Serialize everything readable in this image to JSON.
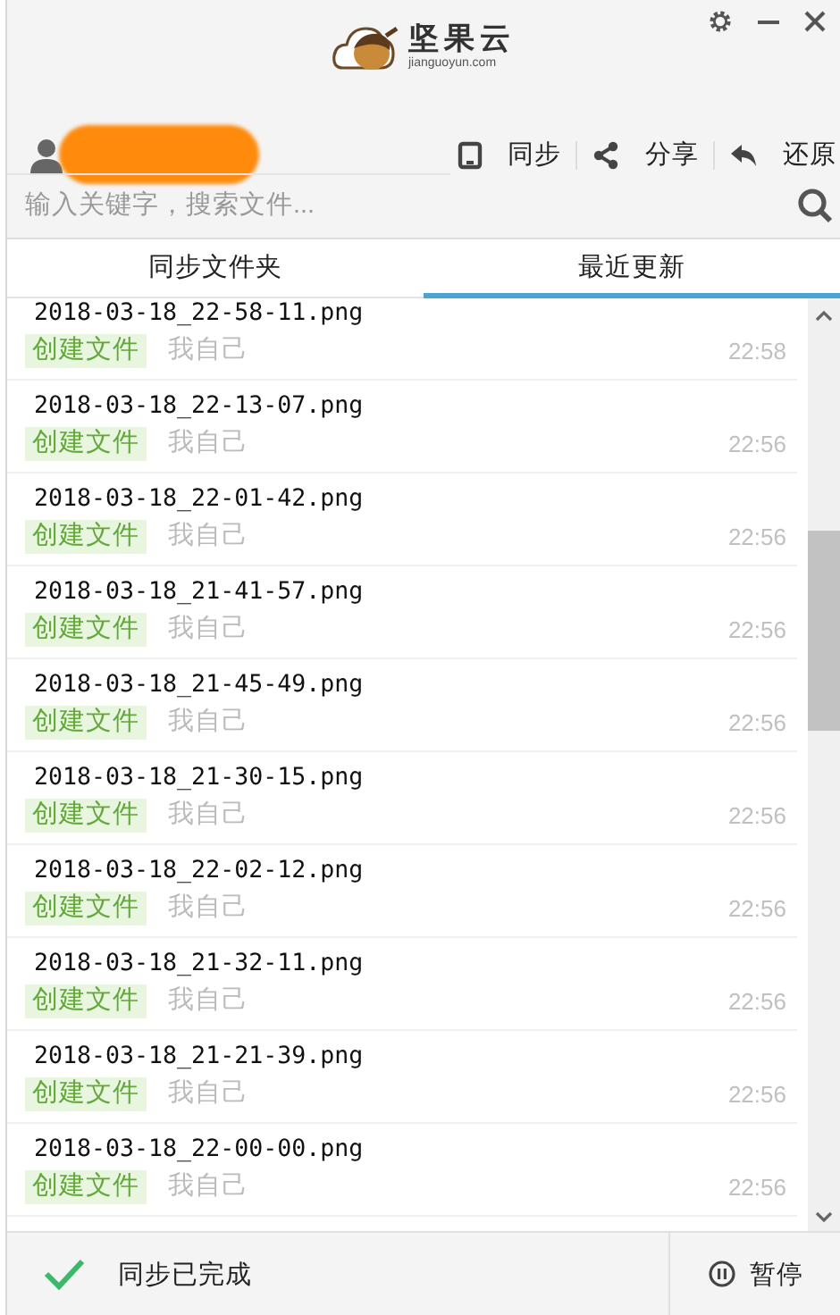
{
  "app": {
    "logo_name": "坚果云",
    "logo_domain": "jianguoyun.com"
  },
  "toolbar": [
    {
      "kind": "sync",
      "label": "同步"
    },
    {
      "kind": "share",
      "label": "分享"
    },
    {
      "kind": "restore",
      "label": "还原"
    }
  ],
  "search": {
    "placeholder": "输入关键字，搜索文件..."
  },
  "tabs": [
    {
      "label": "同步文件夹",
      "selected": false
    },
    {
      "label": "最近更新",
      "selected": true
    }
  ],
  "files": [
    {
      "name": "2018-03-18_22-58-11.png",
      "action": "创建文件",
      "user": "我自己",
      "time": "22:58"
    },
    {
      "name": "2018-03-18_22-13-07.png",
      "action": "创建文件",
      "user": "我自己",
      "time": "22:56"
    },
    {
      "name": "2018-03-18_22-01-42.png",
      "action": "创建文件",
      "user": "我自己",
      "time": "22:56"
    },
    {
      "name": "2018-03-18_21-41-57.png",
      "action": "创建文件",
      "user": "我自己",
      "time": "22:56"
    },
    {
      "name": "2018-03-18_21-45-49.png",
      "action": "创建文件",
      "user": "我自己",
      "time": "22:56"
    },
    {
      "name": "2018-03-18_21-30-15.png",
      "action": "创建文件",
      "user": "我自己",
      "time": "22:56"
    },
    {
      "name": "2018-03-18_22-02-12.png",
      "action": "创建文件",
      "user": "我自己",
      "time": "22:56"
    },
    {
      "name": "2018-03-18_21-32-11.png",
      "action": "创建文件",
      "user": "我自己",
      "time": "22:56"
    },
    {
      "name": "2018-03-18_21-21-39.png",
      "action": "创建文件",
      "user": "我自己",
      "time": "22:56"
    },
    {
      "name": "2018-03-18_22-00-00.png",
      "action": "创建文件",
      "user": "我自己",
      "time": "22:56"
    }
  ],
  "status": {
    "text": "同步已完成",
    "pause_label": "暂停"
  }
}
